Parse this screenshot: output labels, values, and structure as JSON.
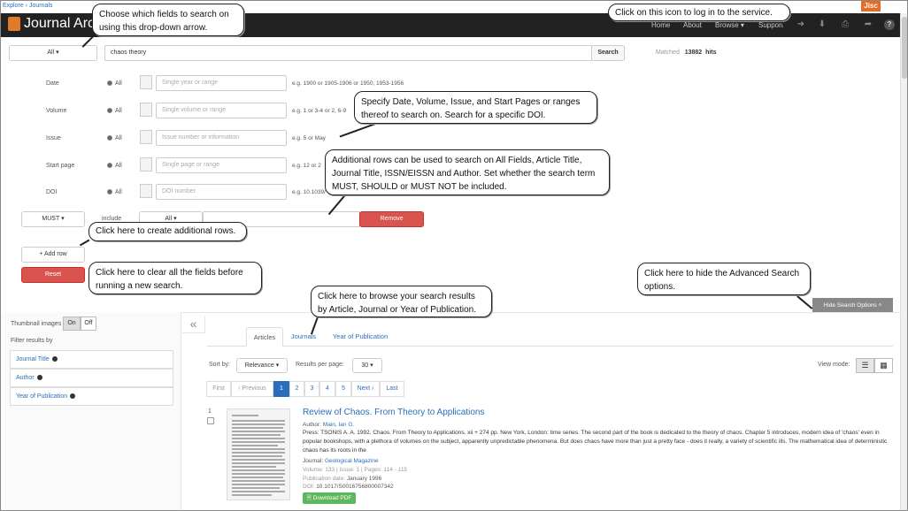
{
  "breadcrumb": {
    "explore": "Explore",
    "sep": " › ",
    "journals": "Journals"
  },
  "brand": {
    "name": "Journal Arch",
    "partner": "Jisc"
  },
  "nav": {
    "home": "Home",
    "about": "About",
    "browse": "Browse ▾",
    "support": "Support"
  },
  "search": {
    "field_select": "All",
    "query": "chaos theory",
    "button": "Search",
    "matched_label": "Matched",
    "matched_count": "13882",
    "hits_label": "hits"
  },
  "advanced": {
    "rows": [
      {
        "label": "Date",
        "radio": "All",
        "placeholder": "Single year or range",
        "example": "e.g. 1900 or 1905-1906 or 1950, 1953-1956"
      },
      {
        "label": "Volume",
        "radio": "All",
        "placeholder": "Single volume or range",
        "example": "e.g. 1 or 3-4 or 2, 6-9"
      },
      {
        "label": "Issue",
        "radio": "All",
        "placeholder": "Issue number or information",
        "example": "e.g. 5 or May"
      },
      {
        "label": "Start page",
        "radio": "All",
        "placeholder": "Single page or range",
        "example": "e.g. 12 or 2"
      },
      {
        "label": "DOI",
        "radio": "All",
        "placeholder": "DOI number",
        "example": "e.g. 10.1039/"
      }
    ],
    "must_select": "MUST",
    "include_label": "include",
    "include_select": "All",
    "remove_button": "Remove",
    "add_row_button": "+ Add row",
    "reset_button": "Reset",
    "hide_options_button": "Hide Search Options"
  },
  "callouts": {
    "dropdown": "Choose which fields to search on using this drop-down arrow.",
    "login": "Click on this icon to log in to the service.",
    "specify": "Specify Date, Volume, Issue, and Start Pages or ranges thereof to search on. Search for a specific DOI.",
    "additional": "Additional rows can be used to search on All Fields, Article Title, Journal Title, ISSN/EISSN and Author. Set whether the search term MUST, SHOULD or MUST NOT be included.",
    "create_rows": "Click here to create additional rows.",
    "clear": "Click here to clear all the fields before running a new search.",
    "browse": "Click here to browse your search results by Article, Journal or Year of Publication.",
    "hide": "Click here to hide the Advanced Search options."
  },
  "sidebar": {
    "thumbnail_label": "Thumbnail images",
    "on": "On",
    "off": "Off",
    "filter_label": "Filter results by",
    "facets": [
      "Journal Title",
      "Author",
      "Year of Publication"
    ],
    "collapse_icon": "«"
  },
  "results": {
    "tabs": [
      "Articles",
      "Journals",
      "Year of Publication"
    ],
    "sort_label": "Sort by:",
    "sort_value": "Relevance",
    "per_page_label": "Results per page:",
    "per_page_value": "30",
    "view_mode_label": "View mode:",
    "pagination": [
      "First",
      "‹ Previous",
      "1",
      "2",
      "3",
      "4",
      "5",
      "Next ›",
      "Last"
    ],
    "items": [
      {
        "index": "1",
        "title": "Review of Chaos. From Theory to Applications",
        "author_label": "Author:",
        "author": "Main, Ian G.",
        "snippet": "Press: TSONIS A. A. 1992. Chaos. From Theory to Applications. xii + 274 pp. New York, London: time series. The second part of the book is dedicated to the theory of chaos. Chapter 5 introduces, modern idea of 'chaos' even in popular bookshops, with a plethora of volumes on the subject, apparently unpredictable phenomena. But does chaos have more than just a pretty face - does it really, a variety of scientific ills. The mathematical idea of deterministic chaos has its roots in the",
        "journal_label": "Journal:",
        "journal": "Geological Magazine",
        "volume_line": "Volume: 133 | Issue: 1 | Pages: 114 - 115",
        "pubdate_label": "Publication date:",
        "pubdate": "January 1996",
        "doi_label": "DOI:",
        "doi": "10.1017/S0016756800007342",
        "download": "Download PDF"
      }
    ]
  }
}
